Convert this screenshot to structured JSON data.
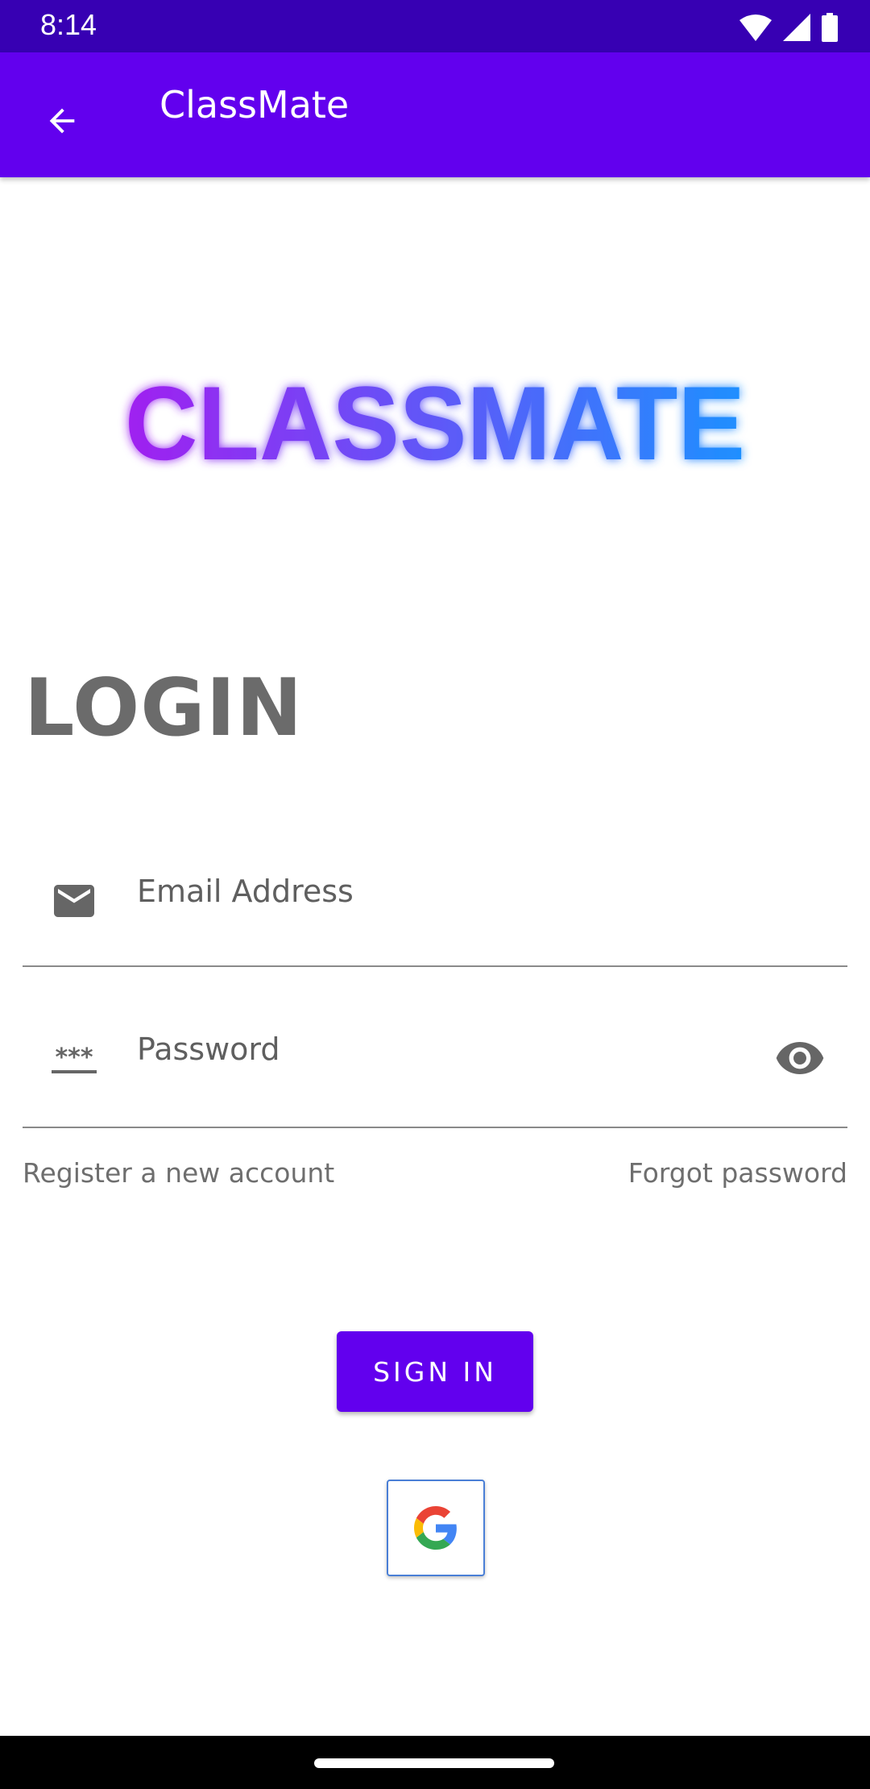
{
  "status_bar": {
    "time": "8:14"
  },
  "app_bar": {
    "title": "ClassMate",
    "back_icon": "arrow-back-icon"
  },
  "logo": {
    "text": "CLASSMATE"
  },
  "login": {
    "heading": "LOGIN",
    "email_placeholder": "Email Address",
    "password_placeholder": "Password",
    "register_link": "Register a new account",
    "forgot_link": "Forgot password",
    "signin_label": "SIGN IN"
  },
  "colors": {
    "status_bar": "#3700b3",
    "app_bar": "#6200ee",
    "accent": "#6200ee",
    "logo_gradient_start": "#a020f0",
    "logo_gradient_end": "#1e90ff"
  },
  "icons": {
    "email": "email-icon",
    "password": "password-icon",
    "visibility": "eye-icon",
    "google": "google-icon"
  }
}
